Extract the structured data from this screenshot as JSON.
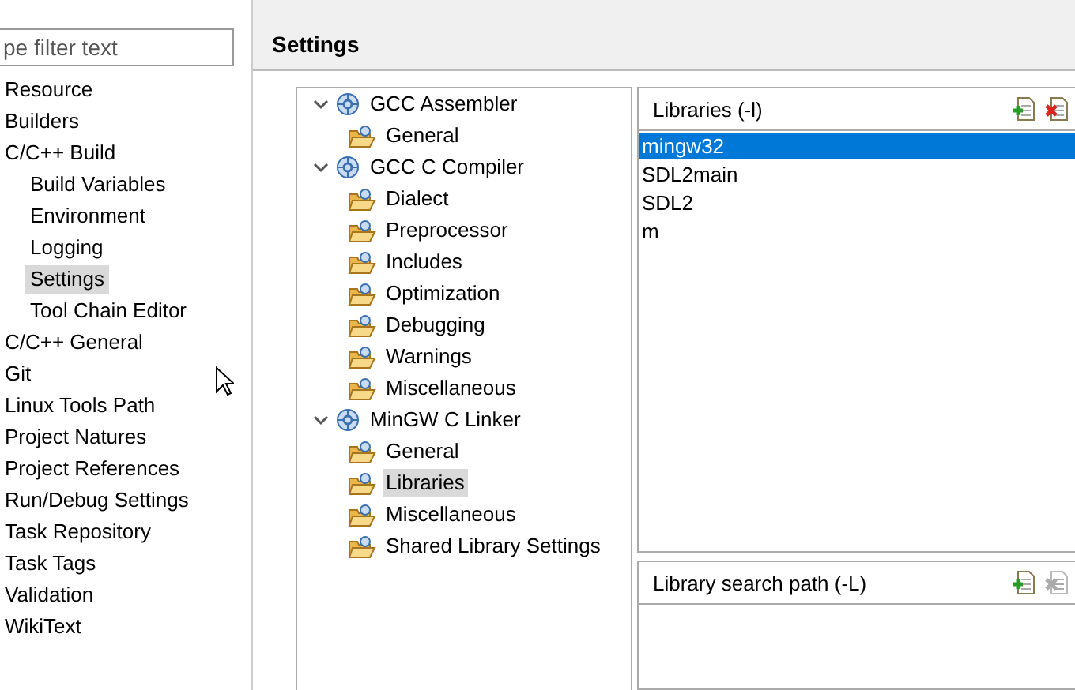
{
  "filter": {
    "placeholder": "pe filter text"
  },
  "sidebar": {
    "items": [
      {
        "label": "Resource",
        "selected": false
      },
      {
        "label": "Builders",
        "selected": false
      },
      {
        "label": "C/C++ Build",
        "selected": false,
        "children": [
          {
            "label": "Build Variables",
            "selected": false
          },
          {
            "label": "Environment",
            "selected": false
          },
          {
            "label": "Logging",
            "selected": false
          },
          {
            "label": "Settings",
            "selected": true
          },
          {
            "label": "Tool Chain Editor",
            "selected": false
          }
        ]
      },
      {
        "label": "C/C++ General",
        "selected": false
      },
      {
        "label": "Git",
        "selected": false
      },
      {
        "label": "Linux Tools Path",
        "selected": false
      },
      {
        "label": "Project Natures",
        "selected": false
      },
      {
        "label": "Project References",
        "selected": false
      },
      {
        "label": "Run/Debug Settings",
        "selected": false
      },
      {
        "label": "Task Repository",
        "selected": false
      },
      {
        "label": "Task Tags",
        "selected": false
      },
      {
        "label": "Validation",
        "selected": false
      },
      {
        "label": "WikiText",
        "selected": false
      }
    ]
  },
  "page_title": "Settings",
  "tree": [
    {
      "label": "GCC Assembler",
      "kind": "tool",
      "expanded": true,
      "selected": false,
      "children": [
        {
          "label": "General",
          "kind": "option",
          "selected": false
        }
      ]
    },
    {
      "label": "GCC C Compiler",
      "kind": "tool",
      "expanded": true,
      "selected": false,
      "children": [
        {
          "label": "Dialect",
          "kind": "option",
          "selected": false
        },
        {
          "label": "Preprocessor",
          "kind": "option",
          "selected": false
        },
        {
          "label": "Includes",
          "kind": "option",
          "selected": false
        },
        {
          "label": "Optimization",
          "kind": "option",
          "selected": false
        },
        {
          "label": "Debugging",
          "kind": "option",
          "selected": false
        },
        {
          "label": "Warnings",
          "kind": "option",
          "selected": false
        },
        {
          "label": "Miscellaneous",
          "kind": "option",
          "selected": false
        }
      ]
    },
    {
      "label": "MinGW C Linker",
      "kind": "tool",
      "expanded": true,
      "selected": false,
      "children": [
        {
          "label": "General",
          "kind": "option",
          "selected": false
        },
        {
          "label": "Libraries",
          "kind": "option",
          "selected": true
        },
        {
          "label": "Miscellaneous",
          "kind": "option",
          "selected": false
        },
        {
          "label": "Shared Library Settings",
          "kind": "option",
          "selected": false
        }
      ]
    }
  ],
  "lists": [
    {
      "title": "Libraries (-l)",
      "tools": [
        {
          "kind": "add",
          "disabled": false
        },
        {
          "kind": "remove",
          "disabled": false
        }
      ],
      "items": [
        {
          "label": "mingw32",
          "selected": true
        },
        {
          "label": "SDL2main",
          "selected": false
        },
        {
          "label": "SDL2",
          "selected": false
        },
        {
          "label": "m",
          "selected": false
        }
      ]
    },
    {
      "title": "Library search path (-L)",
      "tools": [
        {
          "kind": "add",
          "disabled": false
        },
        {
          "kind": "remove",
          "disabled": true
        }
      ]
    }
  ]
}
